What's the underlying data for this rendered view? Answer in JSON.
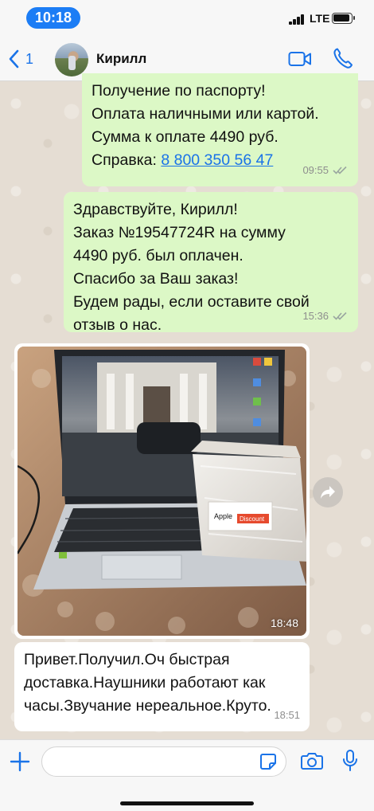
{
  "status_bar": {
    "time": "10:18",
    "network": "LTE"
  },
  "header": {
    "back_count": "1",
    "contact_name": "Кирилл"
  },
  "messages": [
    {
      "direction": "outgoing",
      "lines": [
        "Получение по паспорту!",
        "Оплата наличными или картой.",
        "Сумма к оплате 4490 руб."
      ],
      "reference_prefix": "Справка: ",
      "phone": "8 800 350 56 47",
      "time": "09:55",
      "status": "read"
    },
    {
      "direction": "outgoing",
      "lines": [
        "Здравствуйте, Кирилл!",
        "Заказ №19547724R на сумму",
        "4490 руб. был оплачен.",
        "Спасибо за Ваш заказ!",
        "Будем рады, если оставите свой",
        "отзыв о нас."
      ],
      "time": "15:36",
      "status": "read"
    },
    {
      "direction": "incoming",
      "type": "photo",
      "box_label": "Apple Discount",
      "time": "18:48"
    },
    {
      "direction": "incoming",
      "lines": [
        "Привет.Получил.Оч быстрая",
        "доставка.Наушники работают как",
        "часы.Звучание нереальное.Круто."
      ],
      "time": "18:51"
    }
  ],
  "input": {
    "placeholder": ""
  },
  "colors": {
    "outgoing_bubble": "#dcf8c6",
    "incoming_bubble": "#ffffff",
    "accent": "#1a73e8",
    "time_pill": "#1c7df5"
  }
}
